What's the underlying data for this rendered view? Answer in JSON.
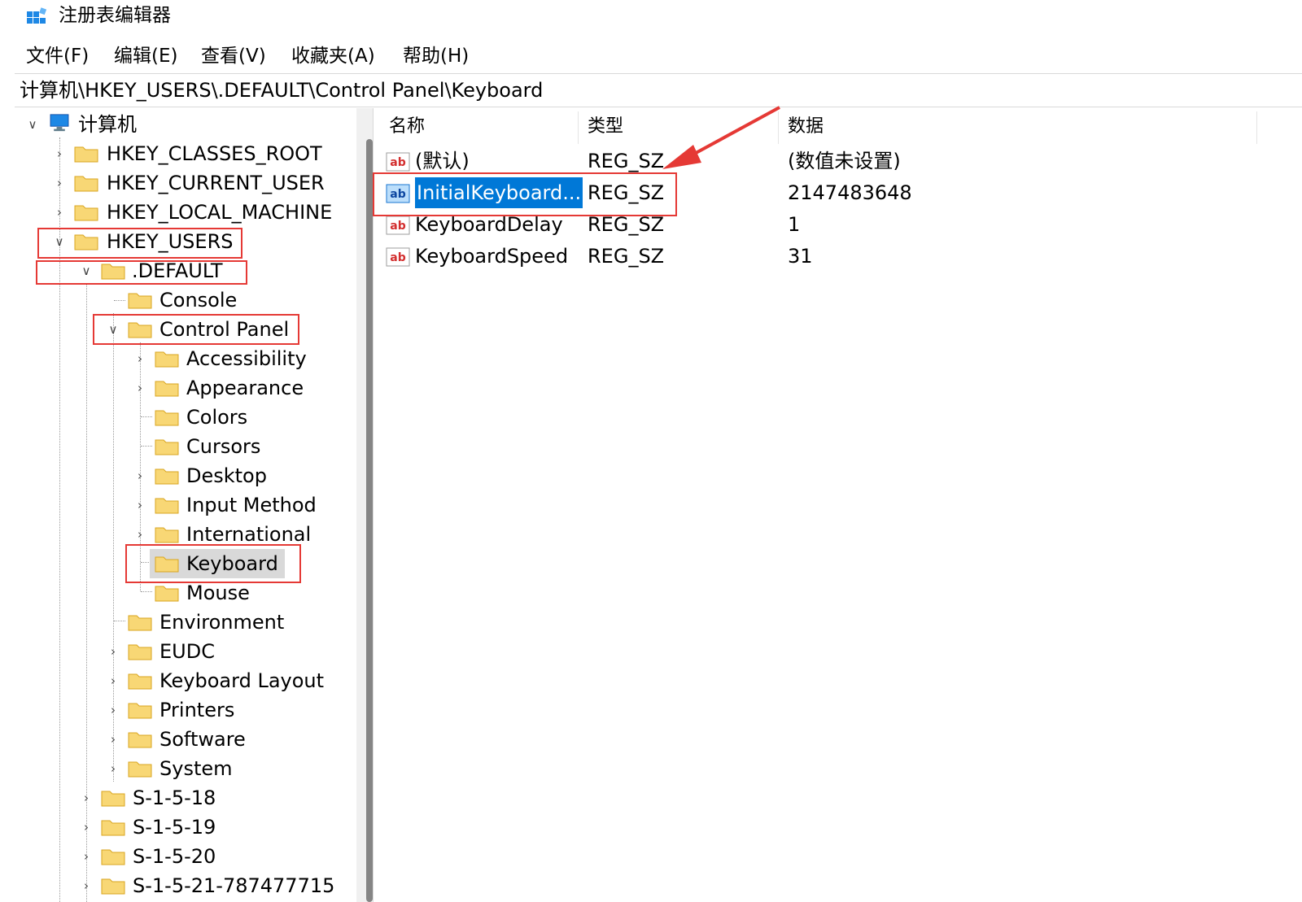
{
  "window": {
    "title": "注册表编辑器"
  },
  "menu": [
    {
      "label": "文件(F)"
    },
    {
      "label": "编辑(E)"
    },
    {
      "label": "查看(V)"
    },
    {
      "label": "收藏夹(A)"
    },
    {
      "label": "帮助(H)"
    }
  ],
  "address": {
    "path": "计算机\\HKEY_USERS\\.DEFAULT\\Control Panel\\Keyboard"
  },
  "tree": {
    "root": "计算机",
    "hives": [
      "HKEY_CLASSES_ROOT",
      "HKEY_CURRENT_USER",
      "HKEY_LOCAL_MACHINE",
      "HKEY_USERS"
    ],
    "users_children": [
      ".DEFAULT",
      "S-1-5-18",
      "S-1-5-19",
      "S-1-5-20",
      "S-1-5-21-787477715"
    ],
    "default_children": [
      "Console",
      "Control Panel",
      "Environment",
      "EUDC",
      "Keyboard Layout",
      "Printers",
      "Software",
      "System"
    ],
    "control_panel_children": [
      "Accessibility",
      "Appearance",
      "Colors",
      "Cursors",
      "Desktop",
      "Input Method",
      "International",
      "Keyboard",
      "Mouse"
    ]
  },
  "columns": {
    "name": "名称",
    "type": "类型",
    "data": "数据"
  },
  "values": [
    {
      "icon": "string-value-icon",
      "name": "(默认)",
      "type": "REG_SZ",
      "data": "(数值未设置)"
    },
    {
      "icon": "string-value-icon",
      "name": "InitialKeyboard...",
      "type": "REG_SZ",
      "data": "2147483648",
      "selected": true
    },
    {
      "icon": "string-value-icon",
      "name": "KeyboardDelay",
      "type": "REG_SZ",
      "data": "1"
    },
    {
      "icon": "string-value-icon",
      "name": "KeyboardSpeed",
      "type": "REG_SZ",
      "data": "31"
    }
  ],
  "colors": {
    "selection": "#0078d7",
    "annotation": "#e53935",
    "folder": "#f8d775",
    "tree_selected_bg": "#d9d9d9"
  }
}
